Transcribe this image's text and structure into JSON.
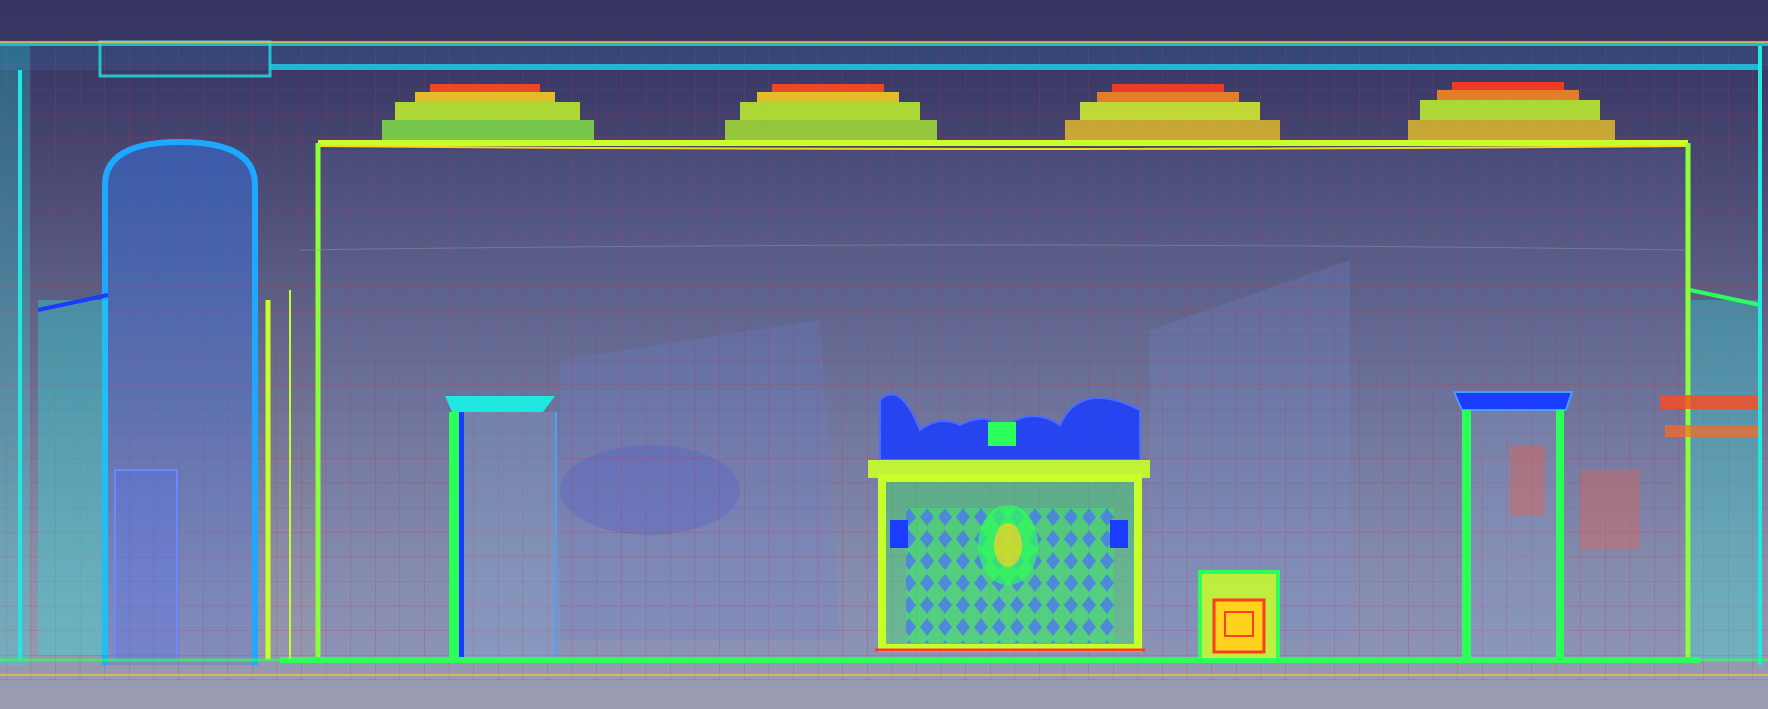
{
  "scene": {
    "kind": "point-cloud-orthographic-elevation",
    "colormap": [
      "#1a3cff",
      "#1fa8ff",
      "#1fe8e0",
      "#2dff5a",
      "#c8ff2a",
      "#ffd21e",
      "#ff3c1e"
    ],
    "grid_color": "#c0303a",
    "bounds_color": "#e8c24a",
    "background_top": "#36345f",
    "background_bottom": "#9b9db5"
  }
}
